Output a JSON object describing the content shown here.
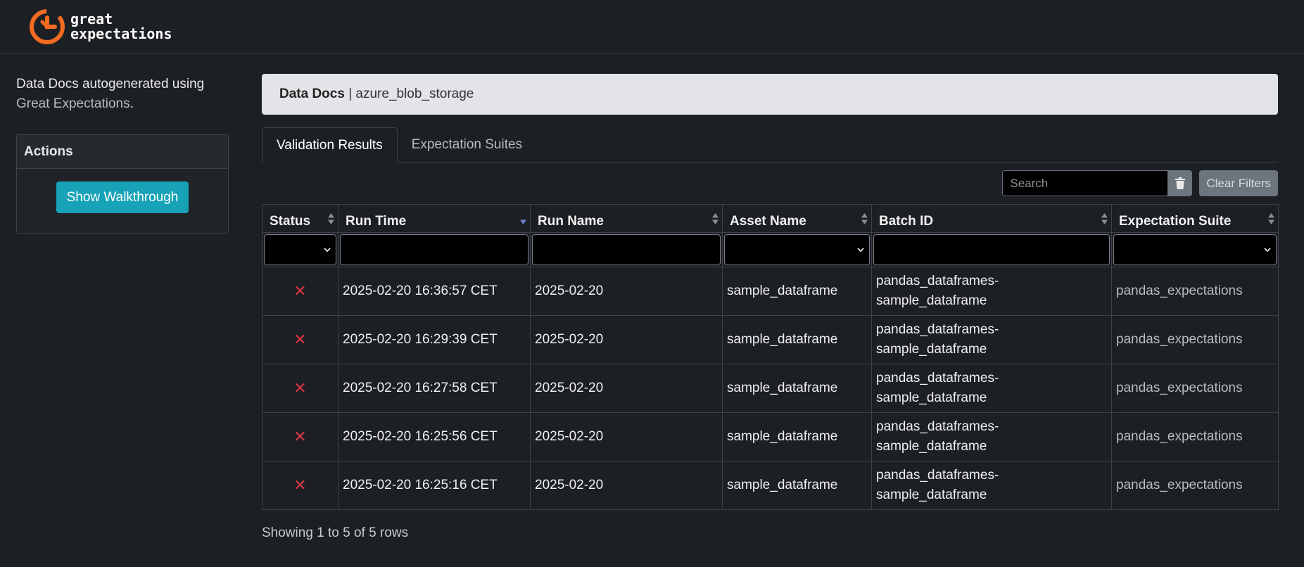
{
  "brand": {
    "line1": "great",
    "line2": "expectations",
    "accent": "#f26b21"
  },
  "sidebar": {
    "intro_prefix": "Data Docs autogenerated using",
    "intro_link": "Great Expectations",
    "intro_suffix": ".",
    "actions_title": "Actions",
    "walkthrough_label": "Show Walkthrough"
  },
  "breadcrumb": {
    "title": "Data Docs",
    "separator": "|",
    "site": "azure_blob_storage"
  },
  "tabs": [
    {
      "label": "Validation Results",
      "active": true
    },
    {
      "label": "Expectation Suites",
      "active": false
    }
  ],
  "toolbar": {
    "search_placeholder": "Search",
    "trash_icon": "trash-icon",
    "clear_filters_label": "Clear Filters"
  },
  "table": {
    "columns": [
      {
        "label": "Status",
        "filter": "select"
      },
      {
        "label": "Run Time",
        "filter": "text",
        "sorted": "desc"
      },
      {
        "label": "Run Name",
        "filter": "text"
      },
      {
        "label": "Asset Name",
        "filter": "select"
      },
      {
        "label": "Batch ID",
        "filter": "text"
      },
      {
        "label": "Expectation Suite",
        "filter": "select"
      }
    ],
    "rows": [
      {
        "status": "✕",
        "run_time": "2025-02-20 16:36:57 CET",
        "run_name": "2025-02-20",
        "asset": "sample_dataframe",
        "batch_line1": "pandas_dataframes-",
        "batch_line2": "sample_dataframe",
        "suite": "pandas_expectations"
      },
      {
        "status": "✕",
        "run_time": "2025-02-20 16:29:39 CET",
        "run_name": "2025-02-20",
        "asset": "sample_dataframe",
        "batch_line1": "pandas_dataframes-",
        "batch_line2": "sample_dataframe",
        "suite": "pandas_expectations"
      },
      {
        "status": "✕",
        "run_time": "2025-02-20 16:27:58 CET",
        "run_name": "2025-02-20",
        "asset": "sample_dataframe",
        "batch_line1": "pandas_dataframes-",
        "batch_line2": "sample_dataframe",
        "suite": "pandas_expectations"
      },
      {
        "status": "✕",
        "run_time": "2025-02-20 16:25:56 CET",
        "run_name": "2025-02-20",
        "asset": "sample_dataframe",
        "batch_line1": "pandas_dataframes-",
        "batch_line2": "sample_dataframe",
        "suite": "pandas_expectations"
      },
      {
        "status": "✕",
        "run_time": "2025-02-20 16:25:16 CET",
        "run_name": "2025-02-20",
        "asset": "sample_dataframe",
        "batch_line1": "pandas_dataframes-",
        "batch_line2": "sample_dataframe",
        "suite": "pandas_expectations"
      }
    ],
    "footer": "Showing 1 to 5 of 5 rows"
  }
}
